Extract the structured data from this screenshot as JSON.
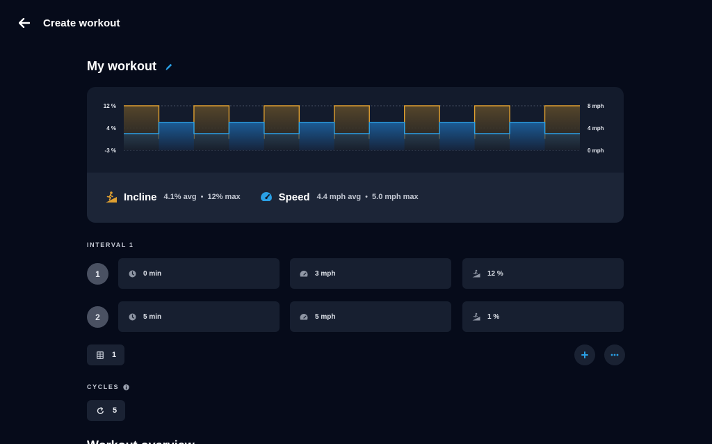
{
  "header": {
    "title": "Create workout"
  },
  "workout": {
    "title": "My workout"
  },
  "chart_data": {
    "type": "area",
    "x_unit": "min",
    "segments": [
      {
        "duration": 5,
        "incline": 12,
        "speed": 3
      },
      {
        "duration": 5,
        "incline": 1,
        "speed": 5
      },
      {
        "duration": 5,
        "incline": 12,
        "speed": 3
      },
      {
        "duration": 5,
        "incline": 1,
        "speed": 5
      },
      {
        "duration": 5,
        "incline": 12,
        "speed": 3
      },
      {
        "duration": 5,
        "incline": 1,
        "speed": 5
      },
      {
        "duration": 5,
        "incline": 12,
        "speed": 3
      },
      {
        "duration": 5,
        "incline": 1,
        "speed": 5
      },
      {
        "duration": 5,
        "incline": 12,
        "speed": 3
      },
      {
        "duration": 5,
        "incline": 1,
        "speed": 5
      },
      {
        "duration": 5,
        "incline": 12,
        "speed": 3
      },
      {
        "duration": 5,
        "incline": 1,
        "speed": 5
      },
      {
        "duration": 5,
        "incline": 12,
        "speed": 3
      }
    ],
    "left_axis": {
      "name": "Incline",
      "unit": "%",
      "min": -3,
      "max": 12,
      "ticks": [
        "12 %",
        "4 %",
        "-3 %"
      ]
    },
    "right_axis": {
      "name": "Speed",
      "unit": "mph",
      "min": 0,
      "max": 8,
      "ticks": [
        "8 mph",
        "4 mph",
        "0 mph"
      ]
    },
    "series": [
      {
        "name": "Incline",
        "color": "#e0a030"
      },
      {
        "name": "Speed",
        "color": "#2aa0e6"
      }
    ],
    "grid": true
  },
  "stats": {
    "incline": {
      "label": "Incline",
      "avg": "4.1% avg",
      "max": "12% max"
    },
    "speed": {
      "label": "Speed",
      "avg": "4.4 mph avg",
      "max": "5.0 mph max"
    },
    "separator": "•"
  },
  "interval": {
    "label": "INTERVAL 1",
    "rows": [
      {
        "num": "1",
        "time": "0 min",
        "speed": "3 mph",
        "incline": "12 %"
      },
      {
        "num": "2",
        "time": "5 min",
        "speed": "5 mph",
        "incline": "1 %"
      }
    ],
    "repeat_count": "1"
  },
  "cycles": {
    "label": "CYCLES",
    "value": "5"
  },
  "next_section": {
    "title": "Workout overview"
  },
  "colors": {
    "background": "#060b1a",
    "card": "#131b2c",
    "accent": "#2aa0e6",
    "incline": "#e0a030"
  },
  "icons": [
    "back-arrow-icon",
    "pencil-icon",
    "incline-icon",
    "speedometer-icon",
    "clock-icon",
    "gauge-icon",
    "incline-small-icon",
    "grid-icon",
    "plus-icon",
    "more-icon",
    "info-icon",
    "repeat-icon"
  ]
}
